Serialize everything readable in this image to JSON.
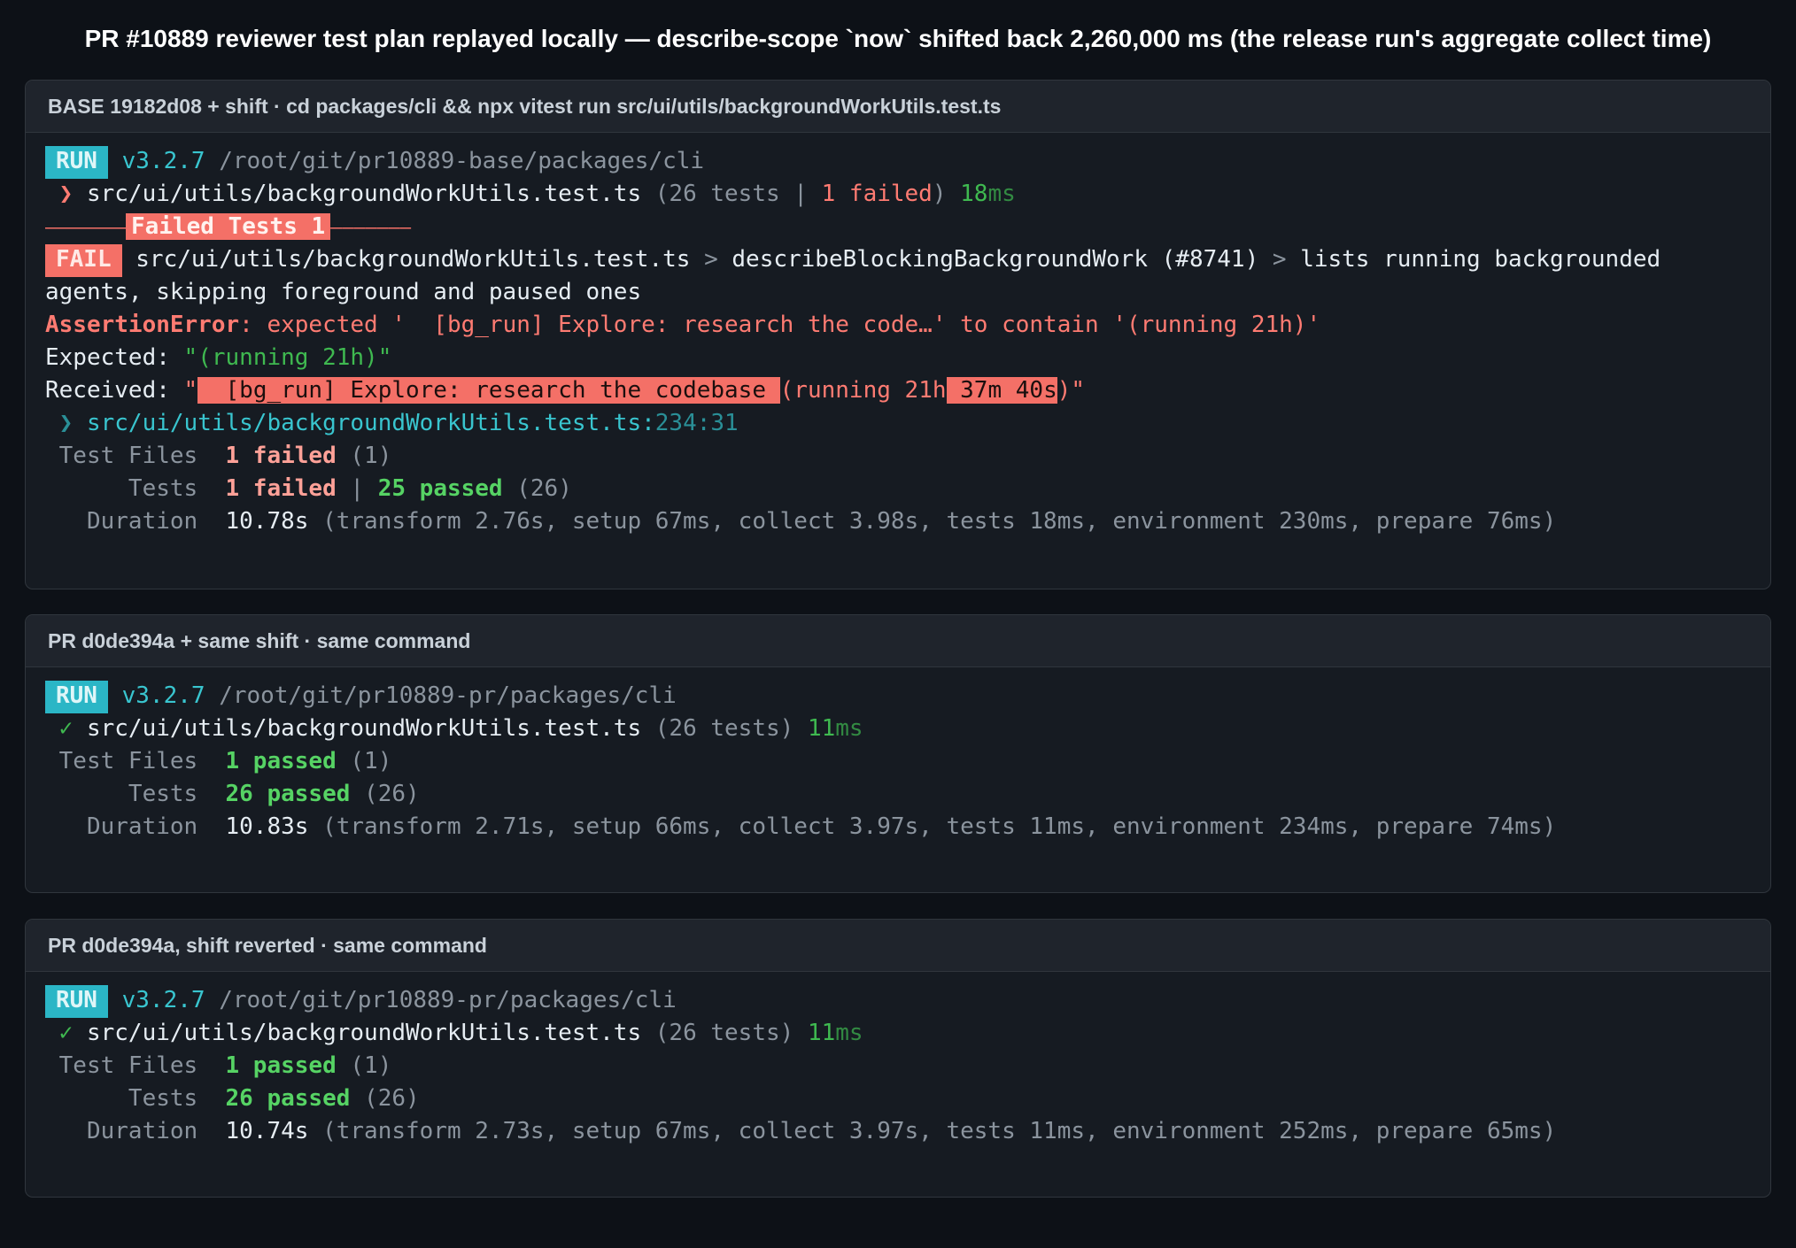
{
  "title": "PR #10889 reviewer test plan replayed locally — describe-scope `now` shifted back 2,260,000 ms (the release run's aggregate collect time)",
  "panels": [
    {
      "header": "BASE 19182d08 + shift · cd packages/cli && npx vitest run src/ui/utils/backgroundWorkUtils.test.ts",
      "run_badge": "RUN",
      "version": "v3.2.7",
      "path": "/root/git/pr10889-base/packages/cli",
      "file_marker": "❯",
      "file": "src/ui/utils/backgroundWorkUtils.test.ts",
      "file_counts_open": "(26 tests | ",
      "file_failed": "1 failed",
      "file_counts_close": ")",
      "file_time_num": "18",
      "file_time_unit": "ms",
      "failed_banner_left": "⎯⎯⎯⎯⎯⎯⎯",
      "failed_banner": "Failed Tests 1",
      "failed_banner_right": "⎯⎯⎯⎯⎯⎯⎯",
      "fail_badge": "FAIL",
      "fail_file": "src/ui/utils/backgroundWorkUtils.test.ts",
      "sep": ">",
      "fail_suite": "describeBlockingBackgroundWork (#8741)",
      "fail_test": "lists running backgrounded agents, skipping foreground and paused ones",
      "assert_label": "AssertionError",
      "assert_msg": ": expected '  [bg_run] Explore: research the code…' to contain '(running 21h)'",
      "expected_label": "Expected: ",
      "expected_value": "\"(running 21h)\"",
      "received_label": "Received: ",
      "received_quote_open": "\"",
      "received_hl1": "  [bg_run] Explore: research the codebase ",
      "received_mid": "(running 21h",
      "received_hl2": " 37m 40s",
      "received_tail": ")\"",
      "loc_marker": "❯",
      "loc_file": "src/ui/utils/backgroundWorkUtils.test.ts:",
      "loc_pos": "234:31",
      "summary_files_label": " Test Files  ",
      "summary_files_val": "1 failed",
      "summary_files_total": " (1)",
      "summary_tests_label": "      Tests  ",
      "summary_tests_failed": "1 failed",
      "summary_tests_sep": " | ",
      "summary_tests_passed": "25 passed",
      "summary_tests_total": " (26)",
      "duration_label": "   Duration  ",
      "duration_total": "10.78s",
      "duration_detail": " (transform 2.76s, setup 67ms, collect 3.98s, tests 18ms, environment 230ms, prepare 76ms)"
    },
    {
      "header": "PR d0de394a + same shift · same command",
      "run_badge": "RUN",
      "version": "v3.2.7",
      "path": "/root/git/pr10889-pr/packages/cli",
      "file_marker": "✓",
      "file": "src/ui/utils/backgroundWorkUtils.test.ts",
      "file_counts": "(26 tests)",
      "file_time_num": "11",
      "file_time_unit": "ms",
      "summary_files_label": " Test Files  ",
      "summary_files_val": "1 passed",
      "summary_files_total": " (1)",
      "summary_tests_label": "      Tests  ",
      "summary_tests_passed": "26 passed",
      "summary_tests_total": " (26)",
      "duration_label": "   Duration  ",
      "duration_total": "10.83s",
      "duration_detail": " (transform 2.71s, setup 66ms, collect 3.97s, tests 11ms, environment 234ms, prepare 74ms)"
    },
    {
      "header": "PR d0de394a, shift reverted · same command",
      "run_badge": "RUN",
      "version": "v3.2.7",
      "path": "/root/git/pr10889-pr/packages/cli",
      "file_marker": "✓",
      "file": "src/ui/utils/backgroundWorkUtils.test.ts",
      "file_counts": "(26 tests)",
      "file_time_num": "11",
      "file_time_unit": "ms",
      "summary_files_label": " Test Files  ",
      "summary_files_val": "1 passed",
      "summary_files_total": " (1)",
      "summary_tests_label": "      Tests  ",
      "summary_tests_passed": "26 passed",
      "summary_tests_total": " (26)",
      "duration_label": "   Duration  ",
      "duration_total": "10.74s",
      "duration_detail": " (transform 2.73s, setup 67ms, collect 3.97s, tests 11ms, environment 252ms, prepare 65ms)"
    }
  ]
}
